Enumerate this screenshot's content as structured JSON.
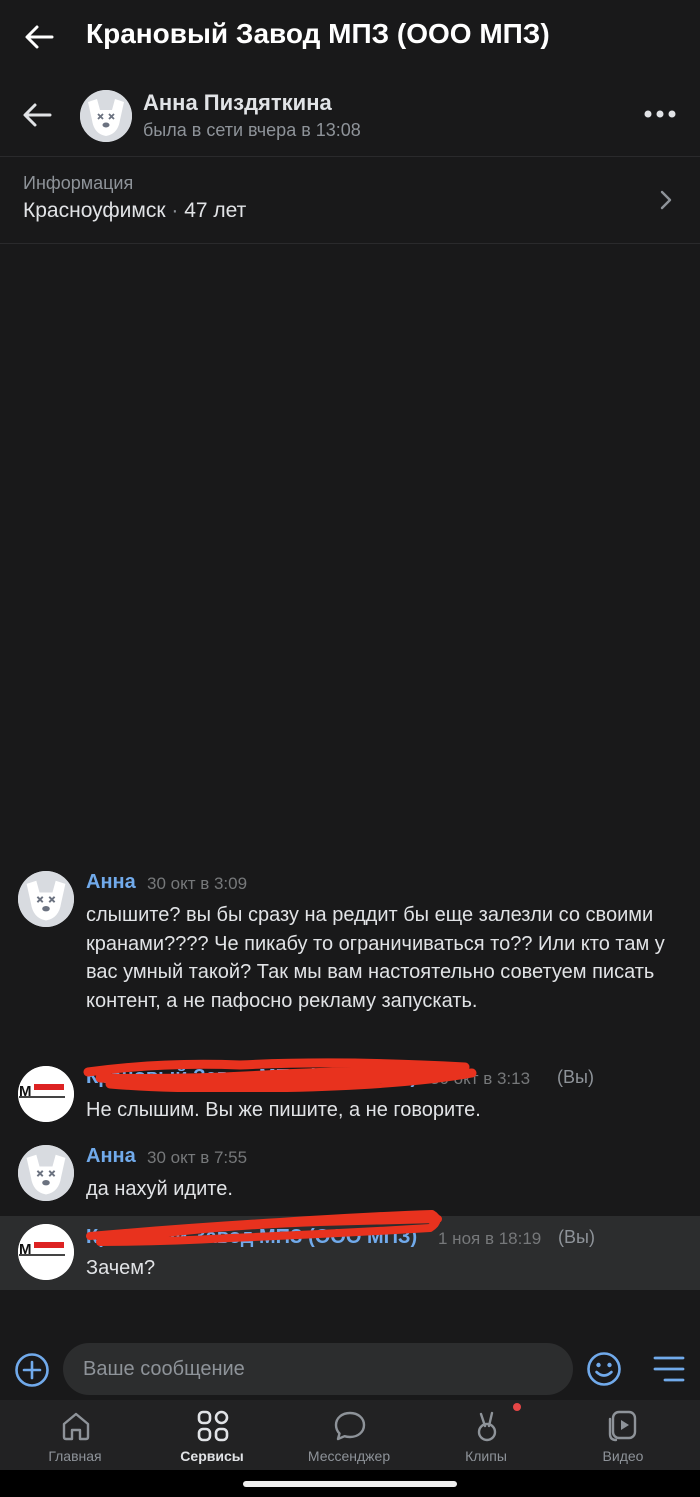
{
  "header": {
    "title": "Крановый Завод МПЗ (ООО МПЗ)"
  },
  "chat": {
    "name": "Анна Пиздяткина",
    "status": "была в сети вчера в 13:08",
    "info_label": "Информация",
    "city": "Красноуфимск",
    "separator": "·",
    "age": "47 лет"
  },
  "messages": [
    {
      "author": "Анна",
      "time": "30 окт в 3:09",
      "text": "слышите? вы бы сразу на реддит бы еще залезли со своими кранами???? Че пикабу то ограничиваться то?? Или кто там у вас умный такой? Так мы вам настоятельно советуем писать контент, а не пафосно рекламу запускать."
    },
    {
      "author": "Крановый Завод МПЗ (ООО МПЗ)",
      "time": "30 окт в 3:13",
      "you": "(Вы)",
      "text": "Не слышим. Вы же пишите, а не говорите."
    },
    {
      "author": "Анна",
      "time": "30 окт в 7:55",
      "text": "да нахуй идите."
    },
    {
      "author": "Крановый Завод МПЗ (ООО МПЗ)",
      "time": "1 ноя в 18:19",
      "you": "(Вы)",
      "text": "Зачем?"
    }
  ],
  "composer": {
    "placeholder": "Ваше сообщение"
  },
  "nav": [
    {
      "label": "Главная",
      "icon": "home-icon"
    },
    {
      "label": "Сервисы",
      "icon": "services-icon",
      "active": true
    },
    {
      "label": "Мессенджер",
      "icon": "messenger-icon"
    },
    {
      "label": "Клипы",
      "icon": "clips-icon",
      "badge": true
    },
    {
      "label": "Видео",
      "icon": "video-icon"
    }
  ],
  "colors": {
    "accent": "#71aaeb",
    "background": "#19191a",
    "badge": "#e64646",
    "redaction": "#e8321e"
  }
}
